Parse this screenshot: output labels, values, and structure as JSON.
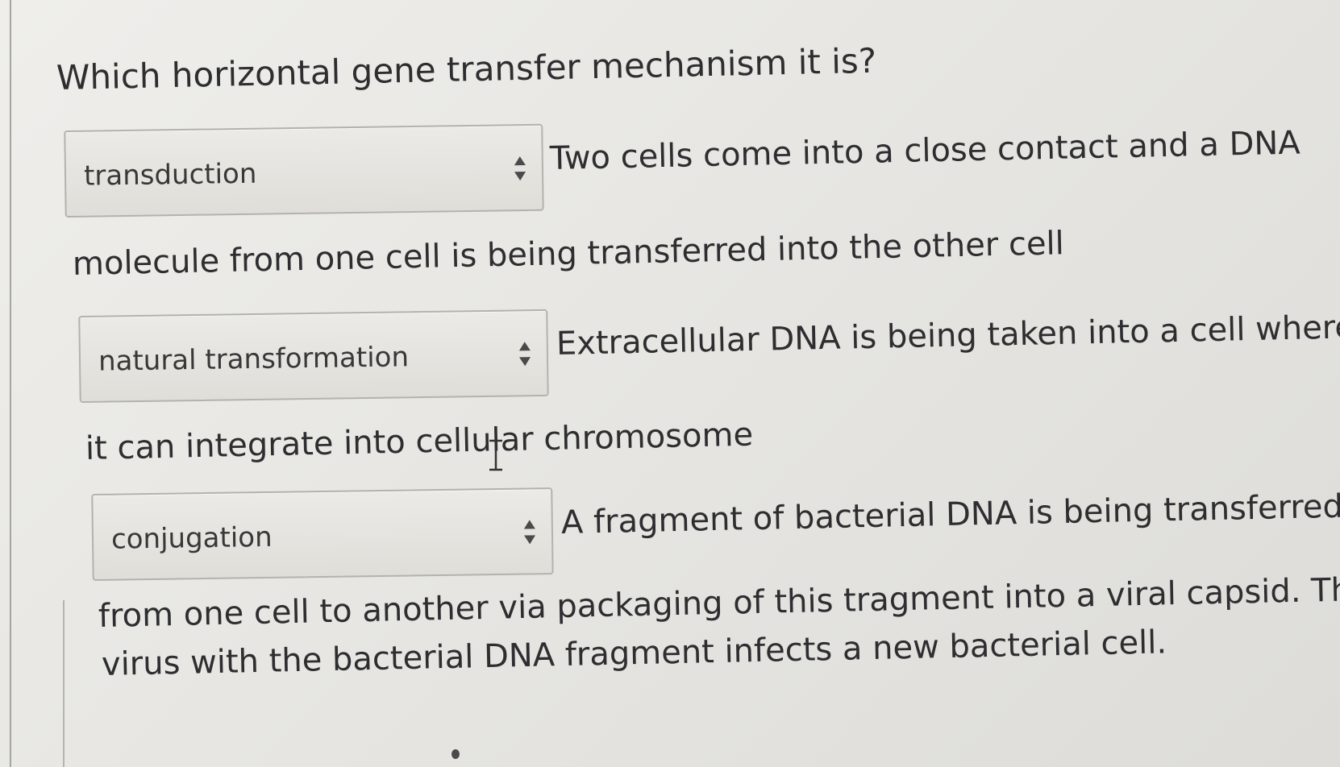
{
  "question": {
    "title": "Which horizontal gene transfer mechanism it is?"
  },
  "items": [
    {
      "selected": "transduction",
      "text_line1": "Two cells come into a close contact  and a DNA",
      "text_line2": "molecule from one cell is being transferred into the other cell"
    },
    {
      "selected": "natural transformation",
      "text_line1": "Extracellular DNA is being taken into a cell where",
      "text_line2": "it can integrate into cellular chromosome"
    },
    {
      "selected": "conjugation",
      "text_line1": "A fragment of bacterial DNA is being transferred",
      "text_line2": "from one cell to another via packaging of this tragment into a viral capsid. The",
      "text_line3": "virus with the bacterial DNA fragment infects a new bacterial cell."
    }
  ],
  "icons": {
    "select_chevrons": "up-down-chevron-icon",
    "cursor": "text-cursor-icon"
  }
}
